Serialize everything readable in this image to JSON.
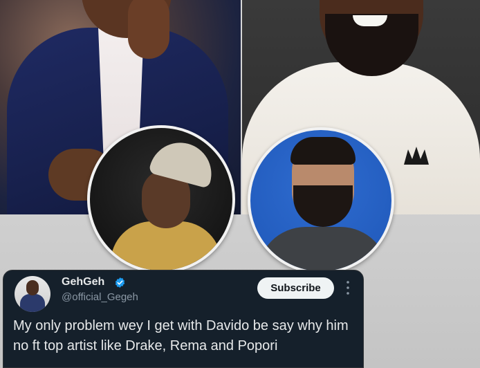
{
  "tweet": {
    "display_name": "GehGeh",
    "handle": "@official_Gegeh",
    "subscribe_label": "Subscribe",
    "text": "My only problem wey I get with Davido be say why him no ft top artist like Drake, Rema and Popori",
    "verified": true
  },
  "icons": {
    "verified": "verified-badge-icon",
    "more": "more-options-icon",
    "brand_mark": "crown-logo-icon"
  },
  "colors": {
    "tweet_background": "#15202b",
    "verified_blue": "#1d9bf0",
    "button_background": "#eff3f4",
    "text_primary": "#e7e9ea",
    "text_secondary": "#8b98a5"
  }
}
